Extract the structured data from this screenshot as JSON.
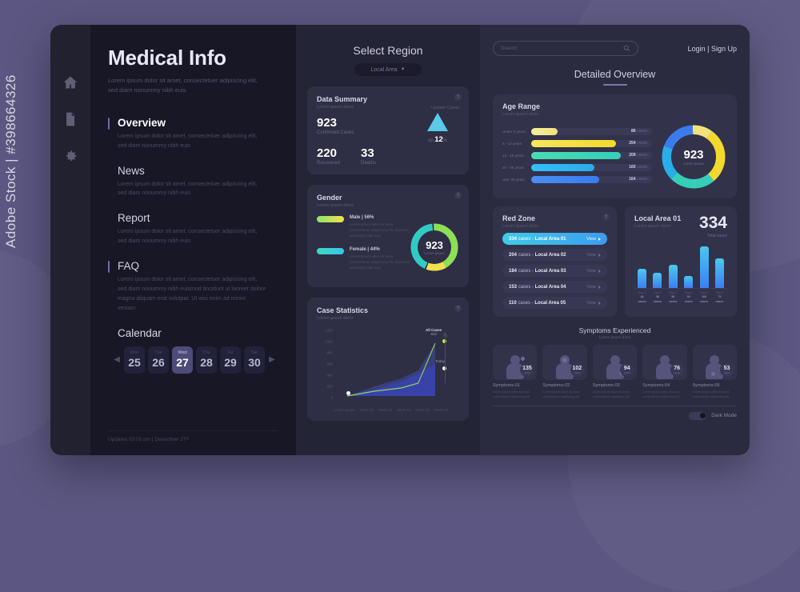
{
  "watermark": "Adobe Stock | #398664326",
  "sidebar_icons": [
    {
      "name": "home-icon"
    },
    {
      "name": "document-icon"
    },
    {
      "name": "gear-icon"
    }
  ],
  "left": {
    "brand": "Medical Info",
    "brand_sub": "Lorem ipsum dolor sit amet, consectetuer adipiscing elit, sed diam nonummy nibh euis",
    "nav": [
      {
        "label": "Overview",
        "desc": "Lorem ipsum dolor sit amet, consectetuer adipiscing elit, sed diam nonummy nibh euis",
        "active": true
      },
      {
        "label": "News",
        "desc": "Lorem ipsum dolor sit amet, consectetuer adipiscing elit, sed diam nonummy nibh euis",
        "active": false
      },
      {
        "label": "Report",
        "desc": "Lorem ipsum dolor sit amet, consectetuer adipiscing elit, sed diam nonummy nibh euis",
        "active": false
      },
      {
        "label": "FAQ",
        "desc": "Lorem ipsum dolor sit amet, consectetuer adipiscing elit, sed diam nonummy nibh euismod tincidunt ut laoreet dolore magna aliquam erat volutpat. Ut wisi enim ad minim veniam.",
        "active": false
      }
    ],
    "calendar": {
      "title": "Calendar",
      "prev": "◀",
      "next": "▶",
      "days": [
        {
          "dow": "Mon",
          "num": "25",
          "selected": false
        },
        {
          "dow": "Tue",
          "num": "26",
          "selected": false
        },
        {
          "dow": "Wed",
          "num": "27",
          "selected": true
        },
        {
          "dow": "Thu",
          "num": "28",
          "selected": false
        },
        {
          "dow": "Fri",
          "num": "29",
          "selected": false
        },
        {
          "dow": "Sat",
          "num": "30",
          "selected": false
        }
      ]
    },
    "footer": "Updates 03:00 pm | December 27ᵗʰ"
  },
  "middle": {
    "header": "Select Region",
    "region_value": "Local Area",
    "region_caret": "▼",
    "summary": {
      "title": "Data Summary",
      "subtitle": "Lorem ipsum dolor",
      "update_label": "Update Cases",
      "confirmed_value": "923",
      "confirmed_label": "Confirmed Cases",
      "recovered_value": "220",
      "recovered_label": "Recovered",
      "deaths_value": "33",
      "deaths_label": "Deaths",
      "trend_prefix": "up",
      "trend_value": "12",
      "trend_unit": "%",
      "help": "?"
    },
    "gender": {
      "title": "Gender",
      "subtitle": "Lorem ipsum dolor",
      "male_label": "Male | 56%",
      "male_desc": "Lorem ipsum dolor sit amet, consectetuer adipiscing elit, sed diam nonummy nibh euis",
      "female_label": "Female | 44%",
      "female_desc": "Lorem ipsum dolor sit amet, consectetuer adipiscing elit, sed diam nonummy nibh euis",
      "center_value": "923",
      "center_label": "Lorem ipsum",
      "help": "?"
    },
    "case_statistics": {
      "title": "Case Statistics",
      "subtitle": "Lorem ipsum dolor",
      "all_cases_label": "All Cases",
      "all_cases_value": "923",
      "today_label": "Today",
      "axis_caption": "Lorem ipsum",
      "help": "?"
    }
  },
  "right": {
    "search_placeholder": "Search",
    "search_value": "",
    "login": "Login | Sign Up",
    "title": "Detailed Overview",
    "age_range": {
      "title": "Age Range",
      "subtitle": "Lorem ipsum dolor",
      "center_value": "923",
      "center_label": "Lorem ipsum",
      "unit": "cases"
    },
    "red_zone": {
      "title": "Red Zone",
      "subtitle": "Lorem ipsum dolor",
      "view_label": "View",
      "unit": "cases",
      "help": "?"
    },
    "local_area": {
      "title": "Local Area 01",
      "subtitle": "Lorem ipsum dolor",
      "total_value": "334",
      "total_label": "Total cases"
    },
    "symptoms": {
      "title": "Symptoms Experienced",
      "subtitle": "Lorem ipsum dolor",
      "unit": "cases",
      "desc": "Lorem ipsum dolor sit amet, consectetuer adipiscing elit"
    },
    "dark_mode_label": "Dark Mode",
    "dark_mode_on": true
  },
  "chart_data": [
    {
      "type": "pie",
      "title": "Gender",
      "categories": [
        "Male",
        "Female"
      ],
      "values": [
        56,
        44
      ],
      "colors": [
        "#9ee04f",
        "#32cbc4"
      ],
      "center": "923"
    },
    {
      "type": "line",
      "title": "Case Statistics",
      "xlabel": "Lorem ipsum",
      "ylabel": "",
      "ylim": [
        0,
        1200
      ],
      "yticks": [
        0,
        200,
        400,
        600,
        800,
        1000,
        1200
      ],
      "categories": [
        "Week 01",
        "Week 02",
        "Week 03",
        "Week 04",
        "Week 05"
      ],
      "series": [
        {
          "name": "All Cases",
          "values": [
            30,
            90,
            140,
            210,
            923
          ],
          "color": "#8ddb5a"
        },
        {
          "name": "Today",
          "values": [
            30,
            150,
            280,
            430,
            560
          ],
          "color": "#3b46c4"
        }
      ],
      "annotations": [
        {
          "label": "All Cases",
          "value": "923"
        },
        {
          "label": "Today",
          "value": ""
        }
      ]
    },
    {
      "type": "bar",
      "title": "Age Range",
      "orientation": "horizontal",
      "categories": [
        "Under 5 years",
        "6 - 12 years",
        "13 - 19 years",
        "20 - 35 years",
        "over 35 years"
      ],
      "values": [
        86,
        254,
        209,
        160,
        164
      ],
      "colors": [
        "#f2e27c",
        "#f5de3f",
        "#3fd3ab",
        "#30b8ef",
        "#3d86f0"
      ],
      "unit": "cases"
    },
    {
      "type": "pie",
      "title": "Age Range Donut",
      "categories": [
        "Under 5 years",
        "6 - 12 years",
        "13 - 19 years",
        "20 - 35 years",
        "over 35 years"
      ],
      "values": [
        86,
        254,
        209,
        160,
        164
      ],
      "colors": [
        "#f2e27c",
        "#f5de3f",
        "#3fd3ab",
        "#30b8ef",
        "#3d86f0"
      ],
      "center": "923"
    },
    {
      "type": "table",
      "title": "Red Zone",
      "columns": [
        "cases",
        "area",
        "action"
      ],
      "rows": [
        {
          "cases": "334",
          "area": "Local Area 01",
          "highlight": true
        },
        {
          "cases": "204",
          "area": "Local Area 02",
          "highlight": false
        },
        {
          "cases": "184",
          "area": "Local Area 03",
          "highlight": false
        },
        {
          "cases": "153",
          "area": "Local Area 04",
          "highlight": false
        },
        {
          "cases": "110",
          "area": "Local Area 05",
          "highlight": false
        }
      ]
    },
    {
      "type": "bar",
      "title": "Local Area 01",
      "categories": [
        "Day 1",
        "Day 2",
        "Day 3",
        "Day 4",
        "Day 5",
        "Day 6"
      ],
      "values": [
        48,
        38,
        58,
        30,
        105,
        75
      ],
      "labels": [
        "48 cases",
        "38 cases",
        "58 cases",
        "30 cases",
        "105 cases",
        "75 cases"
      ],
      "ylim": [
        0,
        110
      ]
    },
    {
      "type": "bar",
      "title": "Symptoms Experienced",
      "categories": [
        "Symptoms-01",
        "Symptoms-02",
        "Symptoms-03",
        "Symptoms-04",
        "Symptoms-05"
      ],
      "values": [
        135,
        102,
        94,
        76,
        53
      ],
      "unit": "cases"
    }
  ]
}
